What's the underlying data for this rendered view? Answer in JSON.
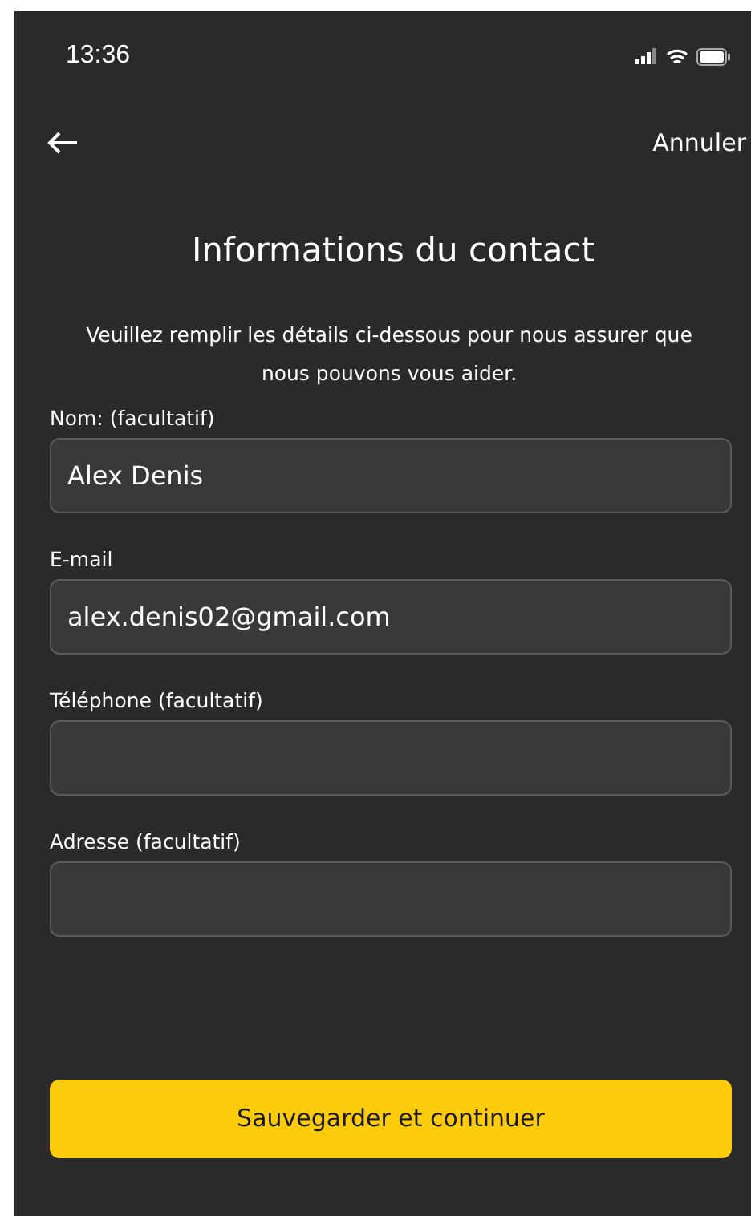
{
  "status_bar": {
    "time": "13:36"
  },
  "nav": {
    "cancel": "Annuler"
  },
  "title": "Informations du contact",
  "intro": "Veuillez remplir les détails ci-dessous pour nous assurer que nous pouvons vous aider.",
  "fields": [
    {
      "label": "Nom: (facultatif)",
      "value": "Alex Denis"
    },
    {
      "label": "E-mail",
      "value": "alex.denis02@gmail.com"
    },
    {
      "label": "Téléphone (facultatif)"
    },
    {
      "label": "Adresse (facultatif)"
    }
  ],
  "primary_button": "Sauvegarder et continuer"
}
